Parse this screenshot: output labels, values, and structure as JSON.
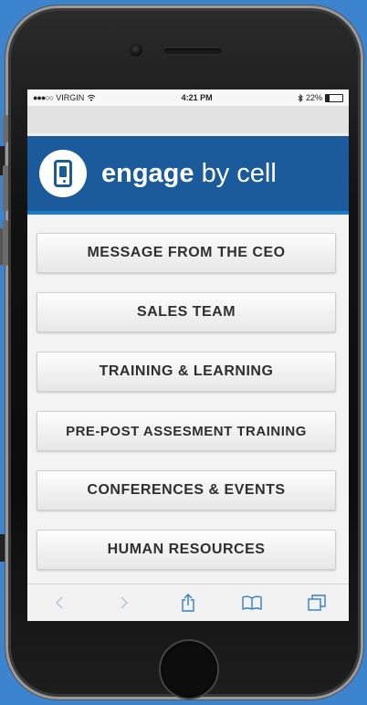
{
  "statusbar": {
    "signal": "●●●○○",
    "carrier": "VIRGIN",
    "wifi": "wifi-icon",
    "time": "4:21 PM",
    "bluetooth": "bluetooth-icon",
    "battery": "22%"
  },
  "brand": {
    "bold": "engage",
    "light": "by cell",
    "color": "#1b5b9b",
    "accent": "#1c7ad0"
  },
  "menu": {
    "items": [
      {
        "label": "MESSAGE FROM THE CEO"
      },
      {
        "label": "SALES TEAM"
      },
      {
        "label": "TRAINING & LEARNING"
      },
      {
        "label": "PRE-POST ASSESMENT TRAINING"
      },
      {
        "label": "CONFERENCES & EVENTS"
      },
      {
        "label": "HUMAN RESOURCES"
      }
    ]
  },
  "toolbar": {
    "icons": [
      "back-icon",
      "forward-icon",
      "share-icon",
      "bookmarks-icon",
      "tabs-icon"
    ]
  },
  "background": "#3d84cf"
}
